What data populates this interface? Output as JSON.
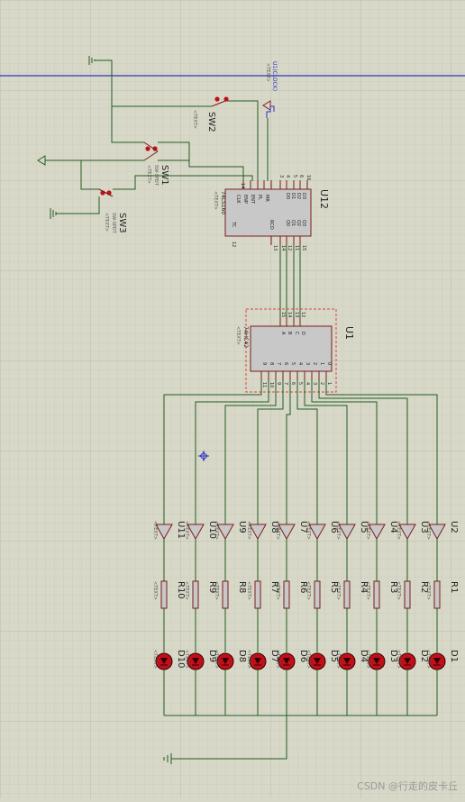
{
  "chips": {
    "u12": {
      "ref": "U12",
      "part": "74LS160",
      "text": "<TEXT>",
      "pins_left": [
        "CLK",
        "ENP",
        "ENT",
        "PL",
        "MR"
      ],
      "pins_right_top": [
        "Q0",
        "Q1",
        "Q2",
        "Q3"
      ],
      "pins_d": [
        "D0",
        "D1",
        "D2",
        "D3"
      ],
      "tc": "TC",
      "rco": "RCO",
      "num_tl": "14",
      "num_br": "12",
      "nums_top": [
        "3",
        "4",
        "5",
        "6",
        "10",
        "7",
        "1",
        "9",
        "2",
        "16"
      ],
      "nums_bottom": [
        "13",
        "12",
        "11",
        "14",
        "15"
      ]
    },
    "u1": {
      "ref": "U1",
      "part": "74HC42",
      "text": "<TEXT>",
      "inputs": [
        "A",
        "B",
        "C",
        "D"
      ],
      "input_nums": [
        "15",
        "14",
        "13",
        "12"
      ],
      "outputs": [
        "0",
        "1",
        "2",
        "3",
        "4",
        "5",
        "6",
        "7",
        "8",
        "9"
      ],
      "output_nums": [
        "1",
        "2",
        "3",
        "4",
        "5",
        "6",
        "7",
        "9",
        "10",
        "11"
      ]
    }
  },
  "switches": [
    {
      "ref": "SW2",
      "text": "<TEXT>"
    },
    {
      "ref": "SW1",
      "sub": "SW-SPDT",
      "text": "<TEXT>"
    },
    {
      "ref": "SW3",
      "sub": "SW-SPDT",
      "text": "<TEXT>"
    }
  ],
  "clock": {
    "label": "U1(CLOCK)",
    "sub": "<TEXT>"
  },
  "row_text": "<TEXT>",
  "buffers": [
    "U11",
    "U10",
    "U9",
    "U8",
    "U7",
    "U6",
    "U5",
    "U4",
    "U3",
    "U2"
  ],
  "resistors": [
    "R10",
    "R9",
    "R8",
    "R7",
    "R6",
    "R5",
    "R4",
    "R3",
    "R2",
    "R1"
  ],
  "leds": [
    "D10",
    "D9",
    "D8",
    "D7",
    "D6",
    "D5",
    "D4",
    "D3",
    "D2",
    "D1"
  ],
  "watermark": "CSDN @行走的皮卡丘",
  "colors": {
    "background": "#d8d8c8",
    "wire": "#1f5c1f",
    "component": "#7a1c1c",
    "body": "#c8c8c8",
    "led": "#c0101a",
    "blue_line": "#3030c0"
  }
}
